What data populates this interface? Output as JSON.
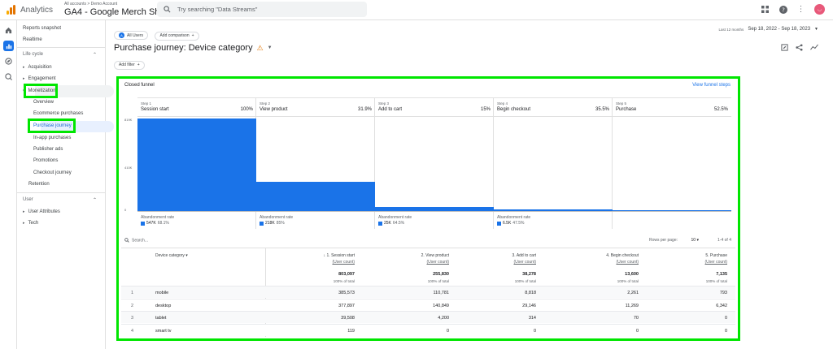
{
  "app": {
    "name": "Analytics",
    "account_crumb": "All accounts > Demo Account",
    "property": "GA4 - Google Merch Shop",
    "search_placeholder": "Try searching \"Data Streams\""
  },
  "nav": {
    "reports_snapshot": "Reports snapshot",
    "realtime": "Realtime",
    "life_cycle": "Life cycle",
    "acquisition": "Acquisition",
    "engagement": "Engagement",
    "monetization": "Monetization",
    "monetization_items": [
      "Overview",
      "Ecommerce purchases",
      "Purchase journey",
      "In-app purchases",
      "Publisher ads",
      "Promotions",
      "Checkout journey"
    ],
    "retention": "Retention",
    "user": "User",
    "user_attributes": "User Attributes",
    "tech": "Tech"
  },
  "header": {
    "segment_chip": "All Users",
    "segment_letter": "A",
    "add_comparison": "Add comparison",
    "date_label": "Last 12 months",
    "date_range": "Sep 18, 2022 - Sep 18, 2023",
    "title": "Purchase journey: Device category",
    "add_filter": "Add filter"
  },
  "funnel": {
    "title": "Closed funnel",
    "view_steps": "View funnel steps",
    "y_ticks": [
      "819K",
      "410K",
      "0"
    ],
    "abandonment_label": "Abandonment rate",
    "steps": [
      {
        "num": "Step 1",
        "name": "Session start",
        "pct": "100%",
        "value": 803097,
        "abandon_count": "547K",
        "abandon_pct": "68.1%"
      },
      {
        "num": "Step 2",
        "name": "View product",
        "pct": "31.9%",
        "value": 255830,
        "abandon_count": "218K",
        "abandon_pct": "85%"
      },
      {
        "num": "Step 3",
        "name": "Add to cart",
        "pct": "15%",
        "value": 38278,
        "abandon_count": "25K",
        "abandon_pct": "64.5%"
      },
      {
        "num": "Step 4",
        "name": "Begin checkout",
        "pct": "35.5%",
        "value": 13600,
        "abandon_count": "6.5K",
        "abandon_pct": "47.5%"
      },
      {
        "num": "Step 5",
        "name": "Purchase",
        "pct": "52.5%",
        "value": 7135,
        "abandon_count": "",
        "abandon_pct": ""
      }
    ],
    "y_max": 819000
  },
  "table": {
    "search": "Search...",
    "rows_per_page_label": "Rows per page:",
    "rows_per_page": "10",
    "pagination": "1-4 of 4",
    "dim_header": "Device category",
    "col_unit": "(User count)",
    "columns": [
      "1. Session start",
      "2. View product",
      "3. Add to cart",
      "4. Begin checkout",
      "5. Purchase"
    ],
    "totals": [
      "803,097",
      "255,830",
      "38,278",
      "13,600",
      "7,135"
    ],
    "totals_pct": "100% of total",
    "rows": [
      {
        "idx": "1",
        "device": "mobile",
        "vals": [
          "385,573",
          "110,781",
          "8,818",
          "2,261",
          "793"
        ]
      },
      {
        "idx": "2",
        "device": "desktop",
        "vals": [
          "377,897",
          "140,849",
          "29,146",
          "11,269",
          "6,342"
        ]
      },
      {
        "idx": "3",
        "device": "tablet",
        "vals": [
          "39,508",
          "4,200",
          "314",
          "70",
          "0"
        ]
      },
      {
        "idx": "4",
        "device": "smart tv",
        "vals": [
          "119",
          "0",
          "0",
          "0",
          "0"
        ]
      }
    ]
  },
  "colors": {
    "accent": "#1a73e8",
    "highlight": "#00e600",
    "warn": "#e37400"
  }
}
